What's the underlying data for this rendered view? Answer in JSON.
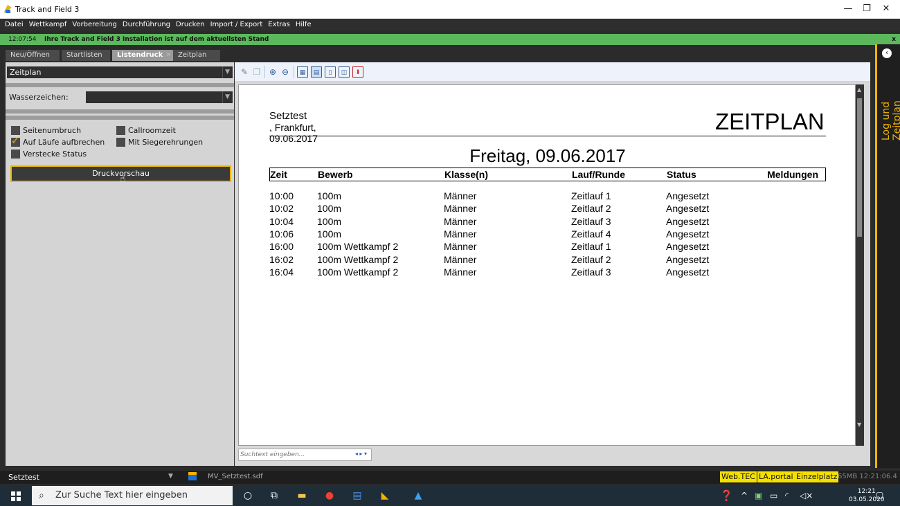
{
  "window": {
    "title": "Track and Field 3",
    "minimize": "—",
    "restore": "❐",
    "close": "✕"
  },
  "menu": [
    "Datei",
    "Wettkampf",
    "Vorbereitung",
    "Durchführung",
    "Drucken",
    "Import / Export",
    "Extras",
    "Hilfe"
  ],
  "notice": {
    "time": "12:07:54",
    "message": "Ihre Track and Field 3 Installation ist auf dem aktuellsten Stand",
    "close": "x"
  },
  "tabs": [
    {
      "label": "Neu/Öffnen"
    },
    {
      "label": "Startlisten"
    },
    {
      "label": "Listendruck",
      "close": "✕"
    },
    {
      "label": "Zeitplan"
    }
  ],
  "left": {
    "report_select": "Zeitplan",
    "watermark_label": "Wasserzeichen:",
    "watermark_value": "",
    "options": [
      {
        "label": "Seitenumbruch",
        "checked": false
      },
      {
        "label": "Callroomzeit",
        "checked": false
      },
      {
        "label": "Auf Läufe aufbrechen",
        "checked": true
      },
      {
        "label": "Mit Siegerehrungen",
        "checked": false
      },
      {
        "label": "Verstecke Status",
        "checked": false
      }
    ],
    "preview_button": "Druckvorschau"
  },
  "viewer": {
    "search_placeholder": "Suchtext eingeben...",
    "search_nav": "◂ ▸ ▾"
  },
  "document": {
    "event_name": "Setztest",
    "place_date": ", Frankfurt, 09.06.2017",
    "heading": "ZEITPLAN",
    "day": "Freitag, 09.06.2017",
    "columns": [
      "Zeit",
      "Bewerb",
      "Klasse(n)",
      "Lauf/Runde",
      "Status",
      "Meldungen"
    ],
    "rows": [
      [
        "10:00",
        "100m",
        "Männer",
        "Zeitlauf 1",
        "Angesetzt",
        ""
      ],
      [
        "10:02",
        "100m",
        "Männer",
        "Zeitlauf 2",
        "Angesetzt",
        ""
      ],
      [
        "10:04",
        "100m",
        "Männer",
        "Zeitlauf 3",
        "Angesetzt",
        ""
      ],
      [
        "10:06",
        "100m",
        "Männer",
        "Zeitlauf 4",
        "Angesetzt",
        ""
      ],
      [
        "16:00",
        "100m Wettkampf 2",
        "Männer",
        "Zeitlauf 1",
        "Angesetzt",
        ""
      ],
      [
        "16:02",
        "100m Wettkampf 2",
        "Männer",
        "Zeitlauf 2",
        "Angesetzt",
        ""
      ],
      [
        "16:04",
        "100m Wettkampf 2",
        "Männer",
        "Zeitlauf 3",
        "Angesetzt",
        ""
      ]
    ]
  },
  "right_panel": {
    "label": "Log und Zeitplan",
    "toggle": "‹"
  },
  "status": {
    "project": "Setztest",
    "file": "MV_Setztest.sdf",
    "badges": [
      "Web.TEC",
      "LA.portal",
      "Einzelplatz"
    ],
    "memory": "65MB  12:21:06.4"
  },
  "taskbar": {
    "search_placeholder": "Zur Suche Text hier eingeben",
    "time": "12:21",
    "date": "03.05.2020"
  }
}
